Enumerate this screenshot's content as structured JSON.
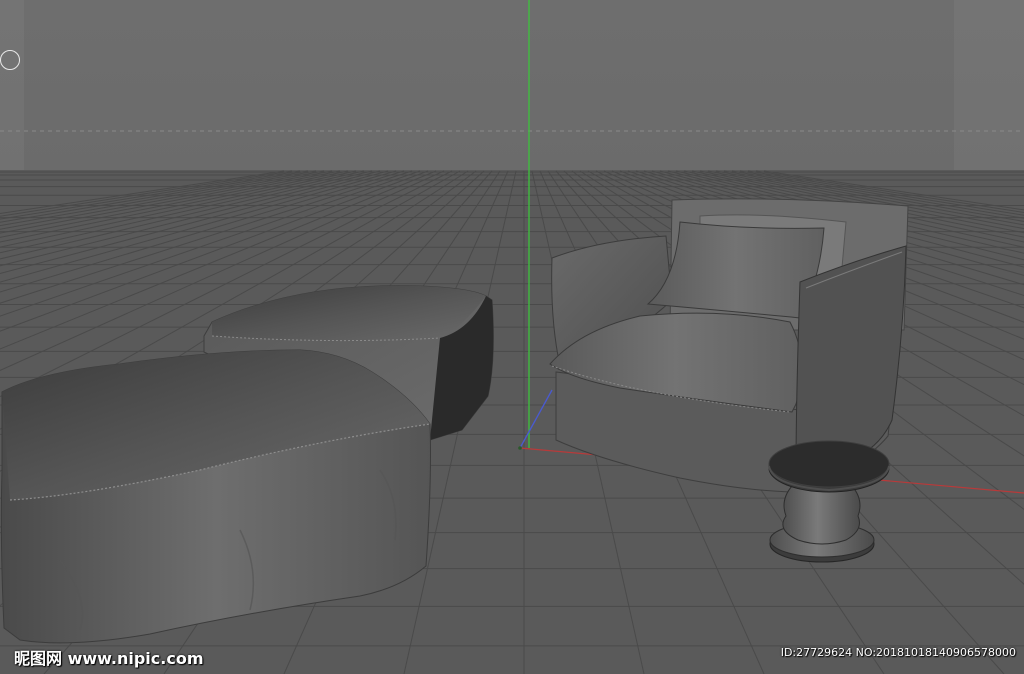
{
  "viewport": {
    "name": "3D perspective viewport",
    "background_color": "#6b6b6b",
    "floor_color": "#5a5a5a",
    "grid_line_color": "#4a4a4a",
    "axis_colors": {
      "x": "#b83a3a",
      "y": "#3cc43c",
      "z": "#4a5ad0"
    }
  },
  "scene_objects": [
    {
      "id": "ottoman-front",
      "label": "slipcovered ottoman (front)"
    },
    {
      "id": "ottoman-back",
      "label": "slipcovered ottoman (back)"
    },
    {
      "id": "armchair",
      "label": "slipcovered armchair with cushions"
    },
    {
      "id": "side-table",
      "label": "round pedestal side table"
    }
  ],
  "icons": {
    "view_gizmo": "circle-icon"
  },
  "watermark": {
    "left_text": "昵图网 www.nipic.com",
    "right_text": "ID:27729624 NO:20181018140906578000"
  }
}
